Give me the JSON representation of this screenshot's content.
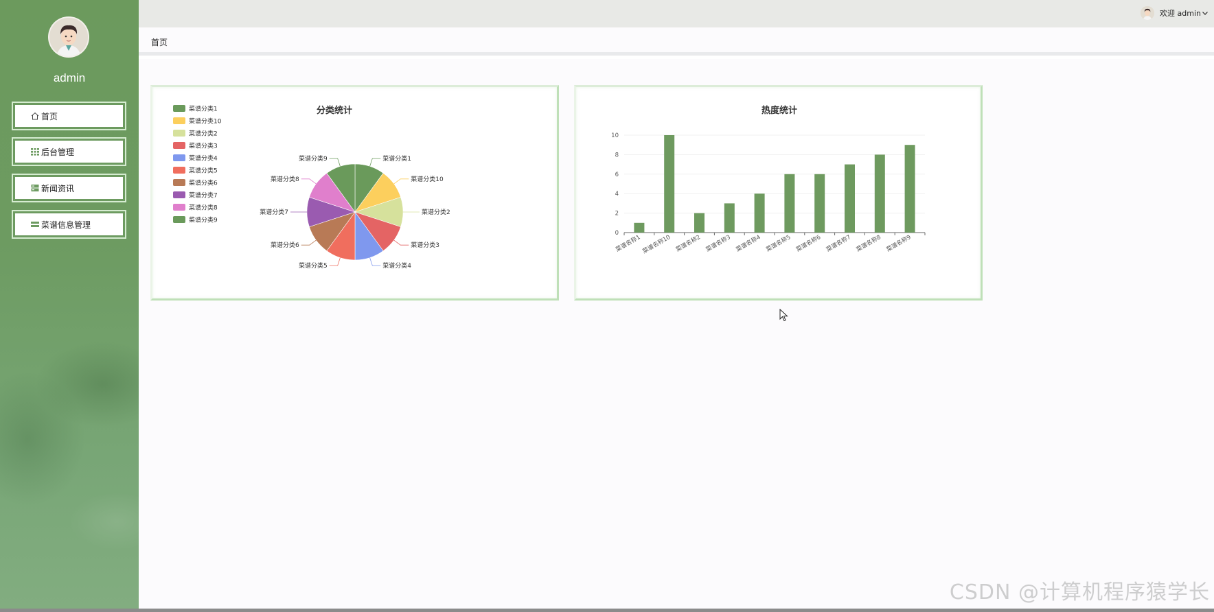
{
  "sidebar": {
    "username": "admin",
    "items": [
      {
        "label": "首页",
        "icon": "home-icon"
      },
      {
        "label": "后台管理",
        "icon": "grid-icon"
      },
      {
        "label": "新闻资讯",
        "icon": "news-icon"
      },
      {
        "label": "菜谱信息管理",
        "icon": "list-icon"
      }
    ]
  },
  "topbar": {
    "greeting": "欢迎 admin"
  },
  "breadcrumb": {
    "current": "首页"
  },
  "colors": {
    "accent": "#6d9b61",
    "bar": "#6e9a5f",
    "card_border": "#bfe0b8"
  },
  "watermark": "CSDN @计算机程序猿学长",
  "chart_data": [
    {
      "type": "pie",
      "title": "分类统计",
      "legend_position": "left",
      "categories": [
        "菜谱分类1",
        "菜谱分类10",
        "菜谱分类2",
        "菜谱分类3",
        "菜谱分类4",
        "菜谱分类5",
        "菜谱分类6",
        "菜谱分类7",
        "菜谱分类8",
        "菜谱分类9"
      ],
      "values": [
        1,
        1,
        1,
        1,
        1,
        1,
        1,
        1,
        1,
        1
      ],
      "colors": [
        "#6a9a5b",
        "#fccf5d",
        "#d6e19c",
        "#e46464",
        "#7f98ee",
        "#f06e5e",
        "#b87a56",
        "#9a5bb0",
        "#e07fcc",
        "#6a9a5b"
      ]
    },
    {
      "type": "bar",
      "title": "热度统计",
      "categories": [
        "菜谱名称1",
        "菜谱名称10",
        "菜谱名称2",
        "菜谱名称3",
        "菜谱名称4",
        "菜谱名称5",
        "菜谱名称6",
        "菜谱名称7",
        "菜谱名称8",
        "菜谱名称9"
      ],
      "values": [
        1,
        10,
        2,
        3,
        4,
        6,
        6,
        7,
        8,
        9
      ],
      "ylim": [
        0,
        10
      ],
      "yticks": [
        0,
        2,
        4,
        6,
        8,
        10
      ],
      "grid": true
    }
  ]
}
